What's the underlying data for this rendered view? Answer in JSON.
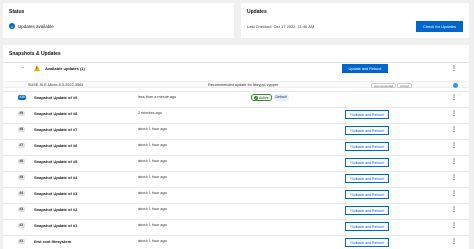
{
  "status_card": {
    "title": "Status",
    "message": "Updates available",
    "icon": "info-icon"
  },
  "updates_card": {
    "title": "Updates",
    "last_checked": "Last Checked: Oct 17 2022, 11:46 AM",
    "check_button": "Check for Updates"
  },
  "main": {
    "title": "Snapshots & Updates",
    "available_updates": {
      "label": "Available updates (1)",
      "apply_button": "Update and Reboot"
    },
    "patch": {
      "id": "SUSE-SLE-Micro-5.3-2022-3564",
      "summary": "Recommended update for libzypp, zypper",
      "tags": [
        "recommended",
        "critical"
      ]
    },
    "active_label": "Active",
    "default_label": "Default",
    "rollback_label": "Rollback and Reboot",
    "snapshots": [
      {
        "badge": "#10",
        "name": "Snapshot Update of #9",
        "time": "less than a minute ago"
      },
      {
        "badge": "#9",
        "name": "Snapshot Update of #8",
        "time": "2 minutes ago"
      },
      {
        "badge": "#8",
        "name": "Snapshot Update of #7",
        "time": "about 1 hour ago"
      },
      {
        "badge": "#7",
        "name": "Snapshot Update of #6",
        "time": "about 1 hour ago"
      },
      {
        "badge": "#6",
        "name": "Snapshot Update of #5",
        "time": "about 1 hour ago"
      },
      {
        "badge": "#5",
        "name": "Snapshot Update of #4",
        "time": "about 1 hour ago"
      },
      {
        "badge": "#4",
        "name": "Snapshot Update of #3",
        "time": "about 1 hour ago"
      },
      {
        "badge": "#3",
        "name": "Snapshot Update of #2",
        "time": "about 1 hour ago"
      },
      {
        "badge": "#2",
        "name": "Snapshot Update of #1",
        "time": "about 1 hour ago"
      },
      {
        "badge": "#1",
        "name": "first root filesystem",
        "time": "about 1 hour ago"
      }
    ]
  },
  "colors": {
    "primary": "#0066cc",
    "warning": "#f0ab00",
    "success": "#3e8635",
    "page_bg": "#f0f0f0"
  }
}
